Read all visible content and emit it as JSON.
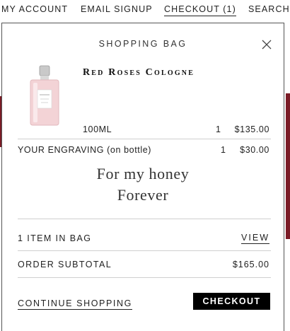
{
  "nav": {
    "account": "MY ACCOUNT",
    "email_signup": "EMAIL SIGNUP",
    "checkout": "CHECKOUT (1)",
    "search": "SEARCH"
  },
  "bag": {
    "title": "SHOPPING BAG",
    "product": {
      "name": "Red Roses Cologne",
      "size": "100ML",
      "qty": "1",
      "price": "$135.00"
    },
    "engraving": {
      "label": "YOUR ENGRAVING (on bottle)",
      "qty": "1",
      "price": "$30.00",
      "line1": "For my honey",
      "line2": "Forever"
    },
    "items_count": "1 ITEM IN BAG",
    "view_label": "VIEW",
    "subtotal_label": "ORDER SUBTOTAL",
    "subtotal_value": "$165.00",
    "continue_label": "CONTINUE SHOPPING",
    "checkout_label": "CHECKOUT"
  },
  "colors": {
    "page_accent": "#7a1b26",
    "button_bg": "#000000",
    "bottle_pink": "#f3d3d6"
  },
  "icons": {
    "close": "close-icon",
    "product": "cologne-bottle-image"
  }
}
